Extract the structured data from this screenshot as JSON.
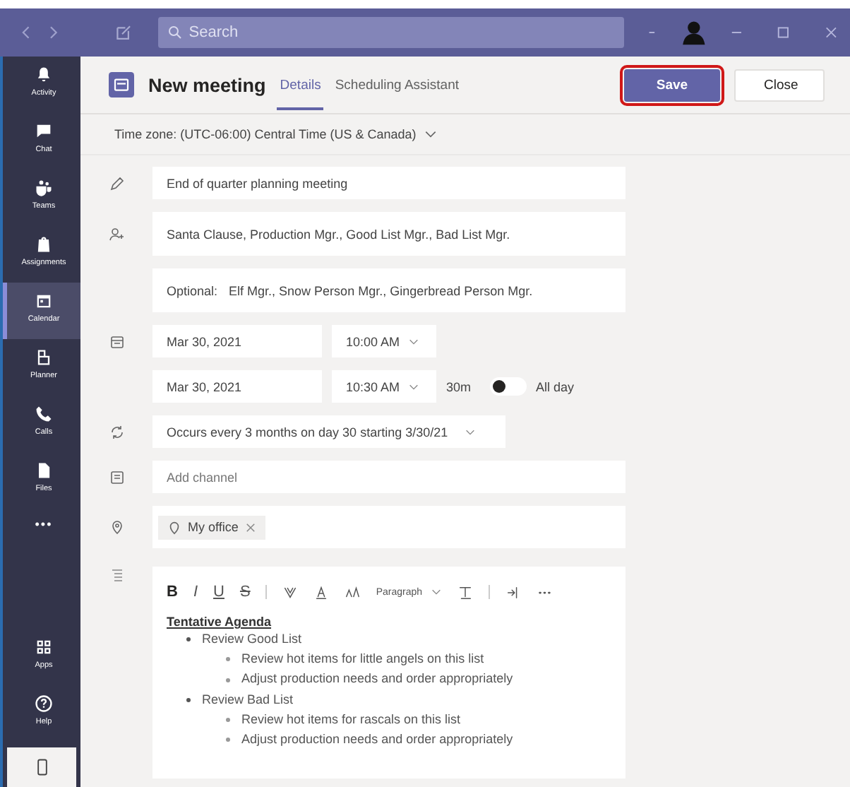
{
  "title_bar": {
    "search_placeholder": "Search"
  },
  "rail": [
    {
      "label": "Activity",
      "selected": false
    },
    {
      "label": "Chat",
      "selected": false
    },
    {
      "label": "Teams",
      "selected": false
    },
    {
      "label": "Assignments",
      "selected": false
    },
    {
      "label": "Calendar",
      "selected": true
    },
    {
      "label": "Planner",
      "selected": false
    },
    {
      "label": "Calls",
      "selected": false
    },
    {
      "label": "Files",
      "selected": false
    },
    {
      "label": "•••",
      "selected": false
    }
  ],
  "rail_bottom": [
    {
      "label": "Apps"
    },
    {
      "label": "Help"
    }
  ],
  "header": {
    "title": "New meeting",
    "tabs": [
      {
        "label": "Details",
        "selected": true
      },
      {
        "label": "Scheduling Assistant",
        "selected": false
      }
    ],
    "buttons": [
      {
        "label": "Save",
        "kind": "primary",
        "highlighted": true
      },
      {
        "label": "Close",
        "kind": "secondary",
        "highlighted": false
      }
    ]
  },
  "time_zone": "Time zone: (UTC-06:00) Central Time (US & Canada)",
  "meeting_title": "End of quarter planning meeting",
  "attendees": "Santa Clause, Production Mgr., Good List Mgr., Bad List Mgr.",
  "optional": {
    "label": "Optional:",
    "value": "Elf Mgr., Snow Person Mgr., Gingerbread Person Mgr."
  },
  "start": {
    "date": "Mar 30, 2021",
    "time": "10:00 AM"
  },
  "end": {
    "date": "Mar 30, 2021",
    "time": "10:30 AM",
    "duration": "30m"
  },
  "all_day": {
    "label": "All day",
    "on": false
  },
  "recurrence": "Occurs every 3 months on day 30 starting 3/30/21",
  "channel_placeholder": "Add channel",
  "location": "My office",
  "toolbar": {
    "format_buttons": [
      "B",
      "I",
      "U",
      "S"
    ],
    "paragraph": "Paragraph"
  },
  "agenda": {
    "heading": "Tentative Agenda",
    "items": [
      {
        "text": "Review Good List",
        "children": [
          {
            "text": "Review hot items for little angels on this list"
          },
          {
            "text": "Adjust production needs and order appropriately"
          }
        ]
      },
      {
        "text": "Review Bad List",
        "children": [
          {
            "text": "Review hot items for rascals on this list"
          },
          {
            "text": "Adjust production needs and order appropriately"
          }
        ]
      }
    ]
  }
}
